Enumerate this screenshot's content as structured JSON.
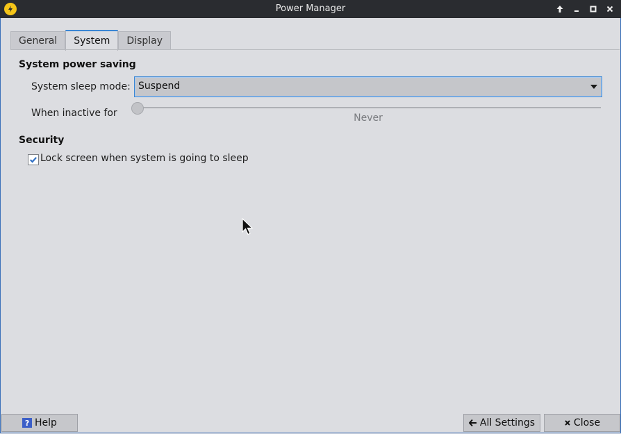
{
  "window": {
    "title": "Power Manager"
  },
  "tabs": [
    {
      "label": "General",
      "active": false
    },
    {
      "label": "System",
      "active": true
    },
    {
      "label": "Display",
      "active": false
    }
  ],
  "power_saving": {
    "heading": "System power saving",
    "sleep_mode_label": "System sleep mode:",
    "sleep_mode_value": "Suspend",
    "inactive_label": "When inactive for",
    "inactive_value": "Never",
    "inactive_slider_fraction": 0
  },
  "security": {
    "heading": "Security",
    "lock_screen_label": "Lock screen when system is going to sleep",
    "lock_screen_checked": true
  },
  "buttons": {
    "help": "Help",
    "all_settings": "All Settings",
    "close": "Close"
  },
  "colors": {
    "accent": "#3a86d4",
    "titlebar": "#2a2c30",
    "background": "#dcdde1",
    "app_icon": "#f5c518"
  },
  "icons": [
    "power-manager-icon",
    "keep-above-icon",
    "minimize-icon",
    "maximize-icon",
    "close-icon",
    "help-icon",
    "arrow-left-icon",
    "close-x-icon",
    "checkmark-icon",
    "mouse-cursor-icon"
  ]
}
